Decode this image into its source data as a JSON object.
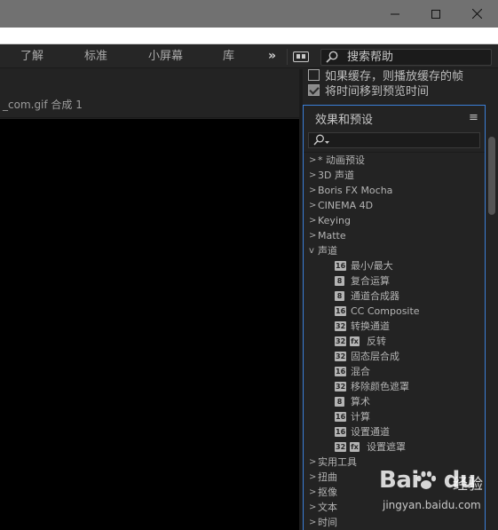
{
  "window": {
    "controls": {
      "minimize_icon": "minimize-icon",
      "maximize_icon": "maximize-icon",
      "close_icon": "close-icon"
    }
  },
  "workspace": {
    "tabs": [
      {
        "label": "了解"
      },
      {
        "label": "标准"
      },
      {
        "label": "小屏幕"
      },
      {
        "label": "库"
      }
    ],
    "more": "»",
    "help_search": {
      "label": "搜索帮助"
    }
  },
  "composition": {
    "tab_label": "_com.gif 合成 1"
  },
  "preview": {
    "cache_option": {
      "label": "如果缓存，则播放缓存的帧",
      "checked": false
    },
    "move_time_option": {
      "label": "将时间移到预览时间",
      "checked": true
    }
  },
  "effects_panel": {
    "title": "效果和预设",
    "menu_icon": "hamburger-menu-icon",
    "tree": [
      {
        "label": "* 动画预设",
        "expanded": false
      },
      {
        "label": "3D 声道",
        "expanded": false
      },
      {
        "label": "Boris FX Mocha",
        "expanded": false
      },
      {
        "label": "CINEMA 4D",
        "expanded": false
      },
      {
        "label": "Keying",
        "expanded": false
      },
      {
        "label": "Matte",
        "expanded": false
      },
      {
        "label": "声道",
        "expanded": true
      },
      {
        "label": "最小/最大",
        "badges": [
          "16"
        ]
      },
      {
        "label": "复合运算",
        "badges": [
          "8"
        ]
      },
      {
        "label": "通道合成器",
        "badges": [
          "8"
        ]
      },
      {
        "label": "CC Composite",
        "badges": [
          "16"
        ]
      },
      {
        "label": "转换通道",
        "badges": [
          "32"
        ]
      },
      {
        "label": "反转",
        "badges": [
          "32",
          "fx"
        ]
      },
      {
        "label": "固态层合成",
        "badges": [
          "32"
        ]
      },
      {
        "label": "混合",
        "badges": [
          "16"
        ]
      },
      {
        "label": "移除颜色遮罩",
        "badges": [
          "32"
        ]
      },
      {
        "label": "算术",
        "badges": [
          "8"
        ]
      },
      {
        "label": "计算",
        "badges": [
          "16"
        ]
      },
      {
        "label": "设置通道",
        "badges": [
          "16"
        ]
      },
      {
        "label": "设置遮罩",
        "badges": [
          "32",
          "fx"
        ]
      },
      {
        "label": "实用工具",
        "expanded": false
      },
      {
        "label": "扭曲",
        "expanded": false
      },
      {
        "label": "抠像",
        "expanded": false
      },
      {
        "label": "文本",
        "expanded": false
      },
      {
        "label": "时间",
        "expanded": false
      }
    ]
  },
  "watermark": {
    "brand": "Bai",
    "brand_suffix": "du",
    "service": "经验",
    "url": "jingyan.baidu.com"
  }
}
